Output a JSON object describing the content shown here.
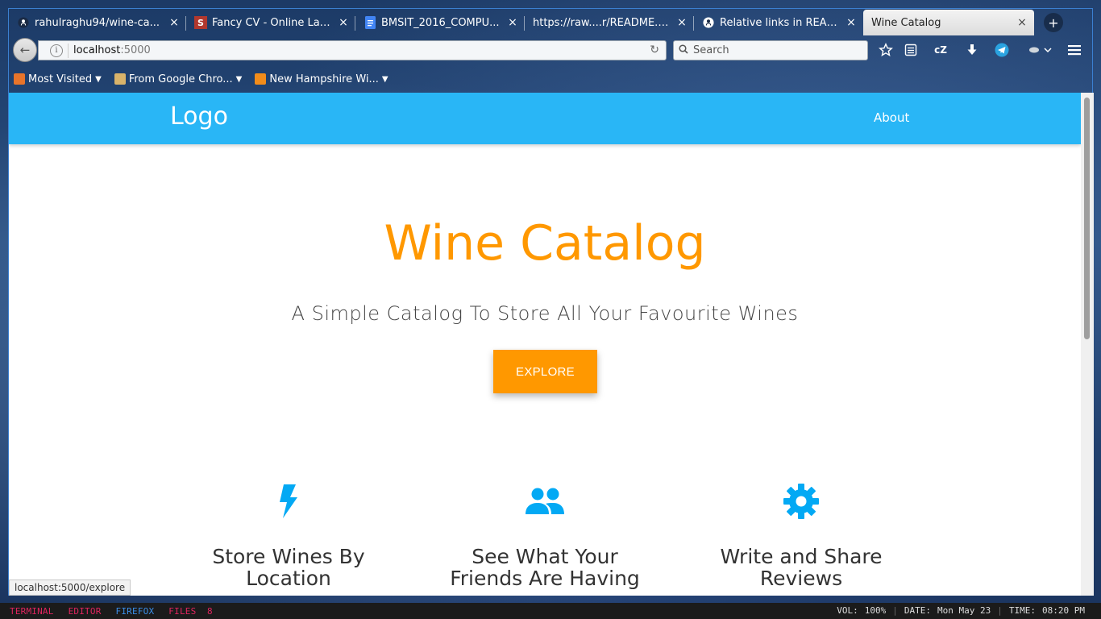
{
  "tabs": [
    {
      "title": "rahulraghu94/wine-ca...",
      "favicon": "github-icon",
      "active": false
    },
    {
      "title": "Fancy CV - Online LaT...",
      "favicon": "sharelatex-icon",
      "active": false
    },
    {
      "title": "BMSIT_2016_COMPU...",
      "favicon": "google-docs-icon",
      "active": false
    },
    {
      "title": "https://raw....r/README.md",
      "favicon": "none",
      "active": false
    },
    {
      "title": "Relative links in READ...",
      "favicon": "github-icon",
      "active": false
    },
    {
      "title": "Wine Catalog",
      "favicon": "none",
      "active": true
    }
  ],
  "tab_close_glyph": "×",
  "newtab_glyph": "+",
  "urlbar": {
    "host": "localhost",
    "port": ":5000"
  },
  "search": {
    "placeholder": "Search"
  },
  "toolbar_icons": [
    "bookmark-star-icon",
    "reader-list-icon",
    "cz-extension-icon",
    "download-icon",
    "telegram-icon",
    "extension-icon",
    "menu-icon"
  ],
  "toolbar_cz_label": "cZ",
  "bookmarks": [
    {
      "label": "Most Visited",
      "icon": "most-visited-icon"
    },
    {
      "label": "From Google Chro...",
      "icon": "folder-icon"
    },
    {
      "label": "New Hampshire Wi...",
      "icon": "rss-icon"
    }
  ],
  "site": {
    "logo": "Logo",
    "nav_about": "About",
    "hero_title": "Wine Catalog",
    "hero_subtitle": "A Simple Catalog To Store All Your Favourite Wines",
    "explore_label": "EXPLORE",
    "accent_color": "#ff9800",
    "nav_color": "#29b6f6",
    "features": [
      {
        "icon": "flash-icon",
        "title": "Store Wines By Location"
      },
      {
        "icon": "group-icon",
        "title": "See What Your Friends Are Having"
      },
      {
        "icon": "settings-gear-icon",
        "title": "Write and Share Reviews"
      }
    ]
  },
  "status_url": "localhost:5000/explore",
  "panel": {
    "workspaces": [
      {
        "label": "TERMINAL",
        "color": "#e0245e"
      },
      {
        "label": "EDITOR",
        "color": "#e0245e"
      },
      {
        "label": "FIREFOX",
        "color": "#3b8ee8"
      },
      {
        "label": "FILES  8",
        "color": "#e0245e"
      }
    ],
    "vol_label": "VOL:",
    "vol_value": "100%",
    "date_label": "DATE:",
    "date_value": "Mon May 23",
    "time_label": "TIME:",
    "time_value": "08:20 PM"
  }
}
